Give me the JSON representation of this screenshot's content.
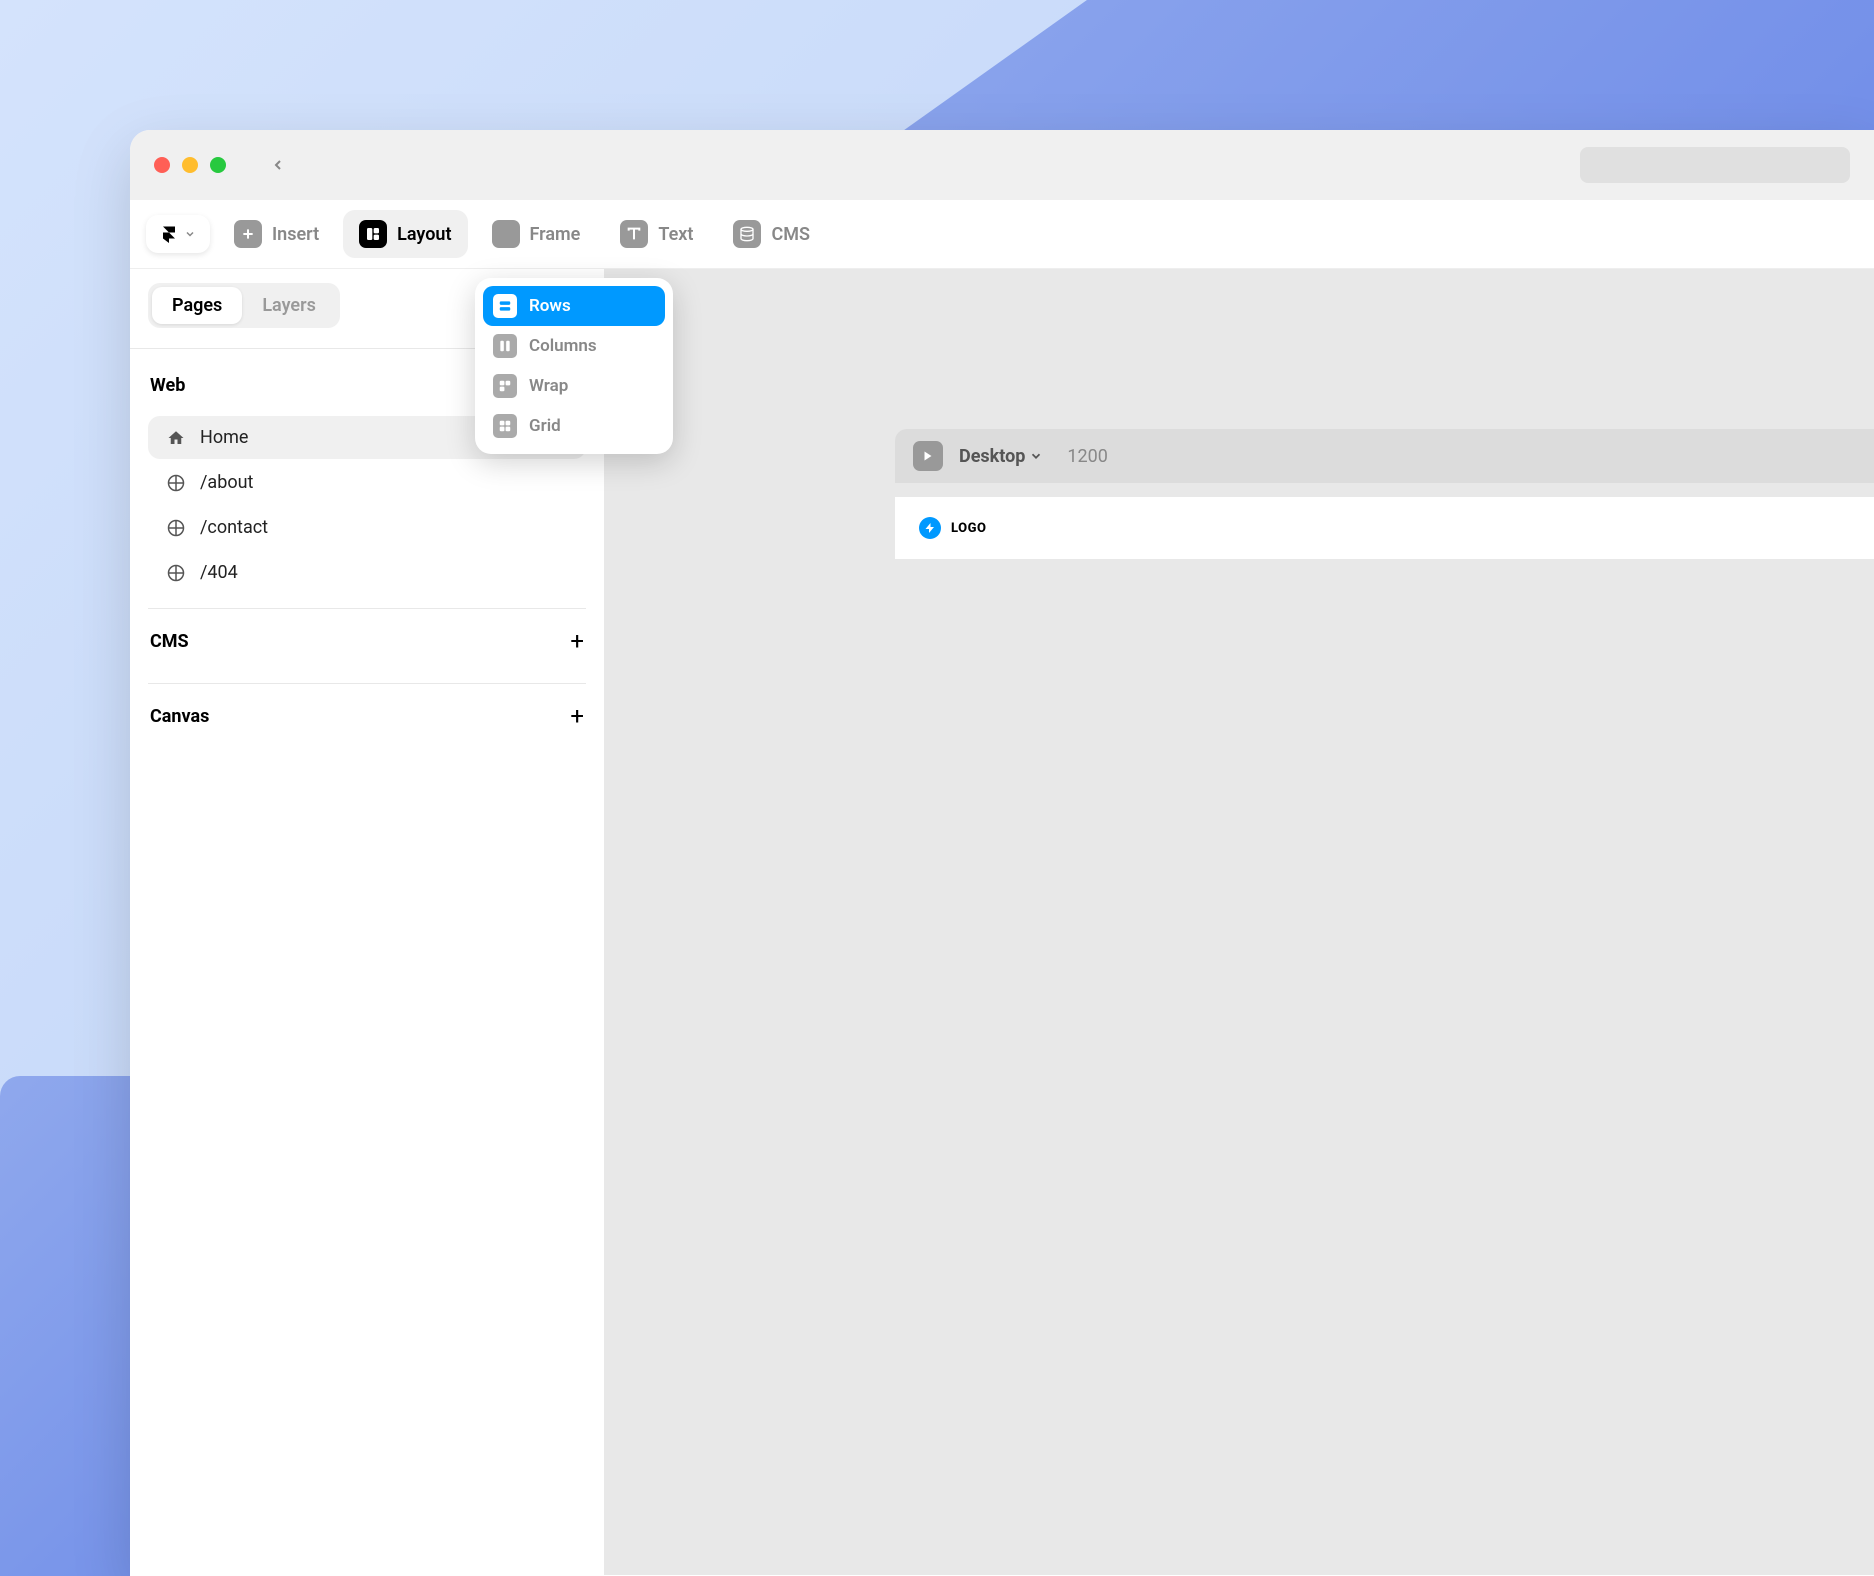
{
  "toolbar": {
    "items": [
      {
        "label": "Insert",
        "icon": "plus",
        "active": false
      },
      {
        "label": "Layout",
        "icon": "layout",
        "active": true
      },
      {
        "label": "Frame",
        "icon": "frame",
        "active": false
      },
      {
        "label": "Text",
        "icon": "text",
        "active": false
      },
      {
        "label": "CMS",
        "icon": "database",
        "active": false
      }
    ]
  },
  "dropdown": {
    "items": [
      {
        "label": "Rows",
        "icon": "rows",
        "selected": true
      },
      {
        "label": "Columns",
        "icon": "columns",
        "selected": false
      },
      {
        "label": "Wrap",
        "icon": "wrap",
        "selected": false
      },
      {
        "label": "Grid",
        "icon": "grid",
        "selected": false
      }
    ]
  },
  "sidebar": {
    "tabs": [
      {
        "label": "Pages",
        "active": true
      },
      {
        "label": "Layers",
        "active": false
      }
    ],
    "sections": {
      "web": {
        "title": "Web",
        "pages": [
          {
            "label": "Home",
            "icon": "home",
            "active": true
          },
          {
            "label": "/about",
            "icon": "globe",
            "active": false
          },
          {
            "label": "/contact",
            "icon": "globe",
            "active": false
          },
          {
            "label": "/404",
            "icon": "globe",
            "active": false
          }
        ]
      },
      "cms": {
        "title": "CMS"
      },
      "canvas": {
        "title": "Canvas"
      }
    }
  },
  "canvas": {
    "breakpoint": {
      "label": "Desktop",
      "value": "1200"
    },
    "logo_text": "LOGO"
  }
}
